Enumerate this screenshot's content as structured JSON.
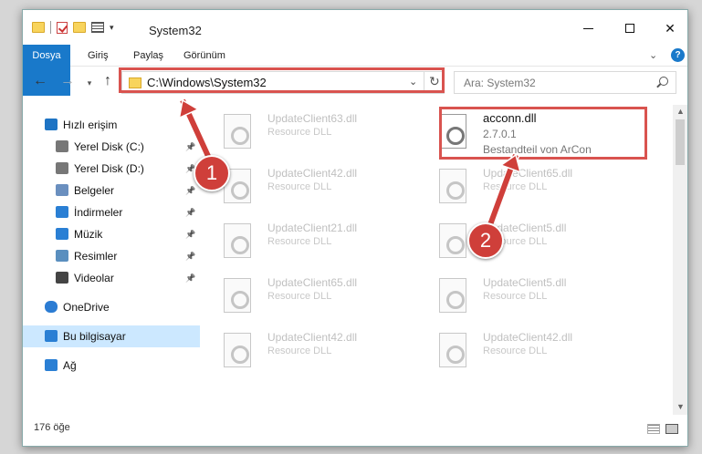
{
  "window": {
    "title": "System32"
  },
  "ribbon": {
    "tabs": [
      {
        "label": "Dosya"
      },
      {
        "label": "Giriş"
      },
      {
        "label": "Paylaş"
      },
      {
        "label": "Görünüm"
      }
    ],
    "help": "?"
  },
  "address": {
    "path": "C:\\Windows\\System32",
    "search_placeholder": "Ara: System32"
  },
  "sidebar": {
    "items": [
      {
        "label": "Hızlı erişim",
        "icon": "star-icon",
        "pinned": false
      },
      {
        "label": "Yerel Disk (C:)",
        "icon": "drive-icon",
        "pinned": true
      },
      {
        "label": "Yerel Disk (D:)",
        "icon": "drive-icon",
        "pinned": true
      },
      {
        "label": "Belgeler",
        "icon": "documents-icon",
        "pinned": true
      },
      {
        "label": "İndirmeler",
        "icon": "downloads-icon",
        "pinned": true
      },
      {
        "label": "Müzik",
        "icon": "music-icon",
        "pinned": true
      },
      {
        "label": "Resimler",
        "icon": "pictures-icon",
        "pinned": true
      },
      {
        "label": "Videolar",
        "icon": "videos-icon",
        "pinned": true
      },
      {
        "label": "OneDrive",
        "icon": "cloud-icon",
        "pinned": false
      },
      {
        "label": "Bu bilgisayar",
        "icon": "computer-icon",
        "pinned": false,
        "selected": true
      },
      {
        "label": "Ağ",
        "icon": "network-icon",
        "pinned": false
      }
    ]
  },
  "files": {
    "main": {
      "name": "acconn.dll",
      "version": "2.7.0.1",
      "description": "Bestandteil von ArCon"
    },
    "faded": [
      {
        "name": "UpdateClient63.dll",
        "desc": "Resource DLL"
      },
      {
        "name": "UpdateClient42.dll",
        "desc": "Resource DLL"
      },
      {
        "name": "UpdateClient65.dll",
        "desc": "Resource DLL"
      },
      {
        "name": "UpdateClient21.dll",
        "desc": "Resource DLL"
      },
      {
        "name": "UpdateClient5.dll",
        "desc": "Resource DLL"
      },
      {
        "name": "UpdateClient65.dll",
        "desc": "Resource DLL"
      },
      {
        "name": "UpdateClient5.dll",
        "desc": "Resource DLL"
      },
      {
        "name": "UpdateClient42.dll",
        "desc": "Resource DLL"
      },
      {
        "name": "UpdateClient42.dll",
        "desc": "Resource DLL"
      }
    ]
  },
  "status": {
    "count": "176 öğe"
  },
  "annotations": {
    "badge1": "1",
    "badge2": "2",
    "color": "#cf3f3a"
  }
}
